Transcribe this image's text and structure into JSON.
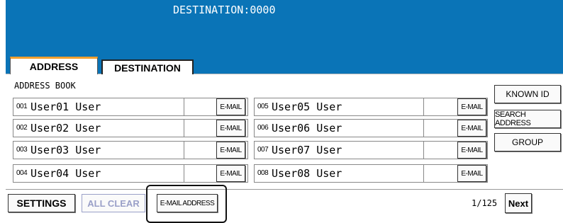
{
  "header": {
    "title": "DESTINATION:0000",
    "color": "#0a74b7"
  },
  "tabs": {
    "address": "ADDRESS",
    "destination": "DESTINATION"
  },
  "address_book": {
    "label": "ADDRESS BOOK",
    "entries": [
      {
        "num": "001",
        "name": "User01 User",
        "button": "E-MAIL"
      },
      {
        "num": "002",
        "name": "User02 User",
        "button": "E-MAIL"
      },
      {
        "num": "003",
        "name": "User03 User",
        "button": "E-MAIL"
      },
      {
        "num": "004",
        "name": "User04 User",
        "button": "E-MAIL"
      },
      {
        "num": "005",
        "name": "User05 User",
        "button": "E-MAIL"
      },
      {
        "num": "006",
        "name": "User06 User",
        "button": "E-MAIL"
      },
      {
        "num": "007",
        "name": "User07 User",
        "button": "E-MAIL"
      },
      {
        "num": "008",
        "name": "User08 User",
        "button": "E-MAIL"
      }
    ]
  },
  "side_buttons": {
    "known_id": "KNOWN ID",
    "search_address": "SEARCH ADDRESS",
    "group": "GROUP"
  },
  "footer": {
    "settings": "SETTINGS",
    "all_clear": "ALL CLEAR",
    "email_address": "E-MAIL ADDRESS",
    "page": "1/125",
    "next": "Next"
  }
}
